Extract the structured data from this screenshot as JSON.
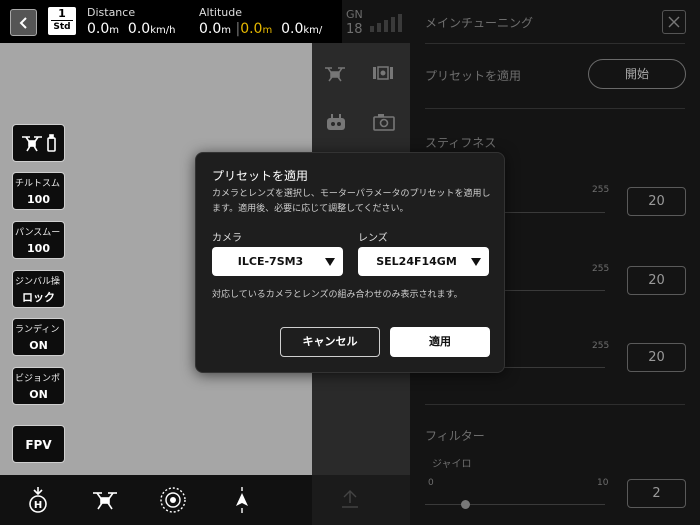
{
  "topbar": {
    "mode_number": "1",
    "mode_label": "Std",
    "distance_label": "Distance",
    "distance_value": "0.0",
    "distance_unit": "m",
    "speed_value": "0.0",
    "speed_unit": "km/h",
    "altitude_label": "Altitude",
    "altitude_value": "0.0",
    "altitude_unit": "m",
    "altitude_highlight_value": "0.0",
    "altitude_highlight_unit": "m",
    "vspeed_unit": "km/",
    "gnss_label": "GN",
    "gnss_count": "18",
    "highlight_color": "#e6b800"
  },
  "sidebar": {
    "aircraft_battery_icon": "drone-battery-icon",
    "items": [
      {
        "label": "チルトスム",
        "value": "100"
      },
      {
        "label": "パンスムー",
        "value": "100"
      },
      {
        "label": "ジンバル操",
        "value": "ロック"
      },
      {
        "label": "ランディン",
        "value": "ON"
      },
      {
        "label": "ビジョンポ",
        "value": "ON"
      }
    ],
    "fpv_label": "FPV"
  },
  "bottombar": {
    "icons": [
      "home-h-icon",
      "drone-icon",
      "target-icon",
      "navigation-arrow-icon"
    ]
  },
  "panel": {
    "title": "メインチューニング",
    "apply_preset_label": "プリセットを適用",
    "start_button": "開始",
    "stiffness_label": "スティフネス",
    "slider_max": "255",
    "values": [
      "20",
      "20",
      "20"
    ],
    "filter_label": "フィルター",
    "gyro_label": "ジャイロ",
    "gyro_min": "0",
    "gyro_max": "10",
    "gyro_value": "2"
  },
  "dialog": {
    "title": "プリセットを適用",
    "description": "カメラとレンズを選択し、モーターパラメータのプリセットを適用します。適用後、必要に応じて調整してください。",
    "camera_label": "カメラ",
    "camera_value": "ILCE-7SM3",
    "lens_label": "レンズ",
    "lens_value": "SEL24F14GM",
    "note": "対応しているカメラとレンズの組み合わせのみ表示されます。",
    "cancel_button": "キャンセル",
    "apply_button": "適用"
  }
}
